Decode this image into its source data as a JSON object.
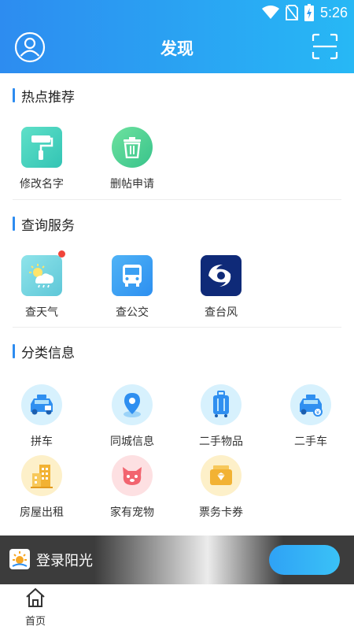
{
  "status_bar": {
    "time": "5:26"
  },
  "header": {
    "title": "发现"
  },
  "sections": [
    {
      "title": "热点推荐",
      "items": [
        {
          "label": "修改名字",
          "icon": "paint-roller-icon"
        },
        {
          "label": "删帖申请",
          "icon": "trash-icon"
        }
      ]
    },
    {
      "title": "查询服务",
      "items": [
        {
          "label": "查天气",
          "icon": "weather-icon"
        },
        {
          "label": "查公交",
          "icon": "bus-icon"
        },
        {
          "label": "查台风",
          "icon": "typhoon-icon"
        }
      ]
    },
    {
      "title": "分类信息",
      "items": [
        {
          "label": "拼车",
          "icon": "carpool-icon"
        },
        {
          "label": "同城信息",
          "icon": "location-pin-icon"
        },
        {
          "label": "二手物品",
          "icon": "suitcase-icon"
        },
        {
          "label": "二手车",
          "icon": "used-car-icon"
        },
        {
          "label": "房屋出租",
          "icon": "building-icon"
        },
        {
          "label": "家有宠物",
          "icon": "pet-icon"
        },
        {
          "label": "票务卡券",
          "icon": "ticket-icon"
        }
      ]
    }
  ],
  "login_banner": {
    "text": "登录阳光"
  },
  "bottom_nav": {
    "home_label": "首页"
  },
  "colors": {
    "header_start": "#2d8cf0",
    "header_end": "#27b8f5",
    "accent": "#2d8cf0"
  }
}
